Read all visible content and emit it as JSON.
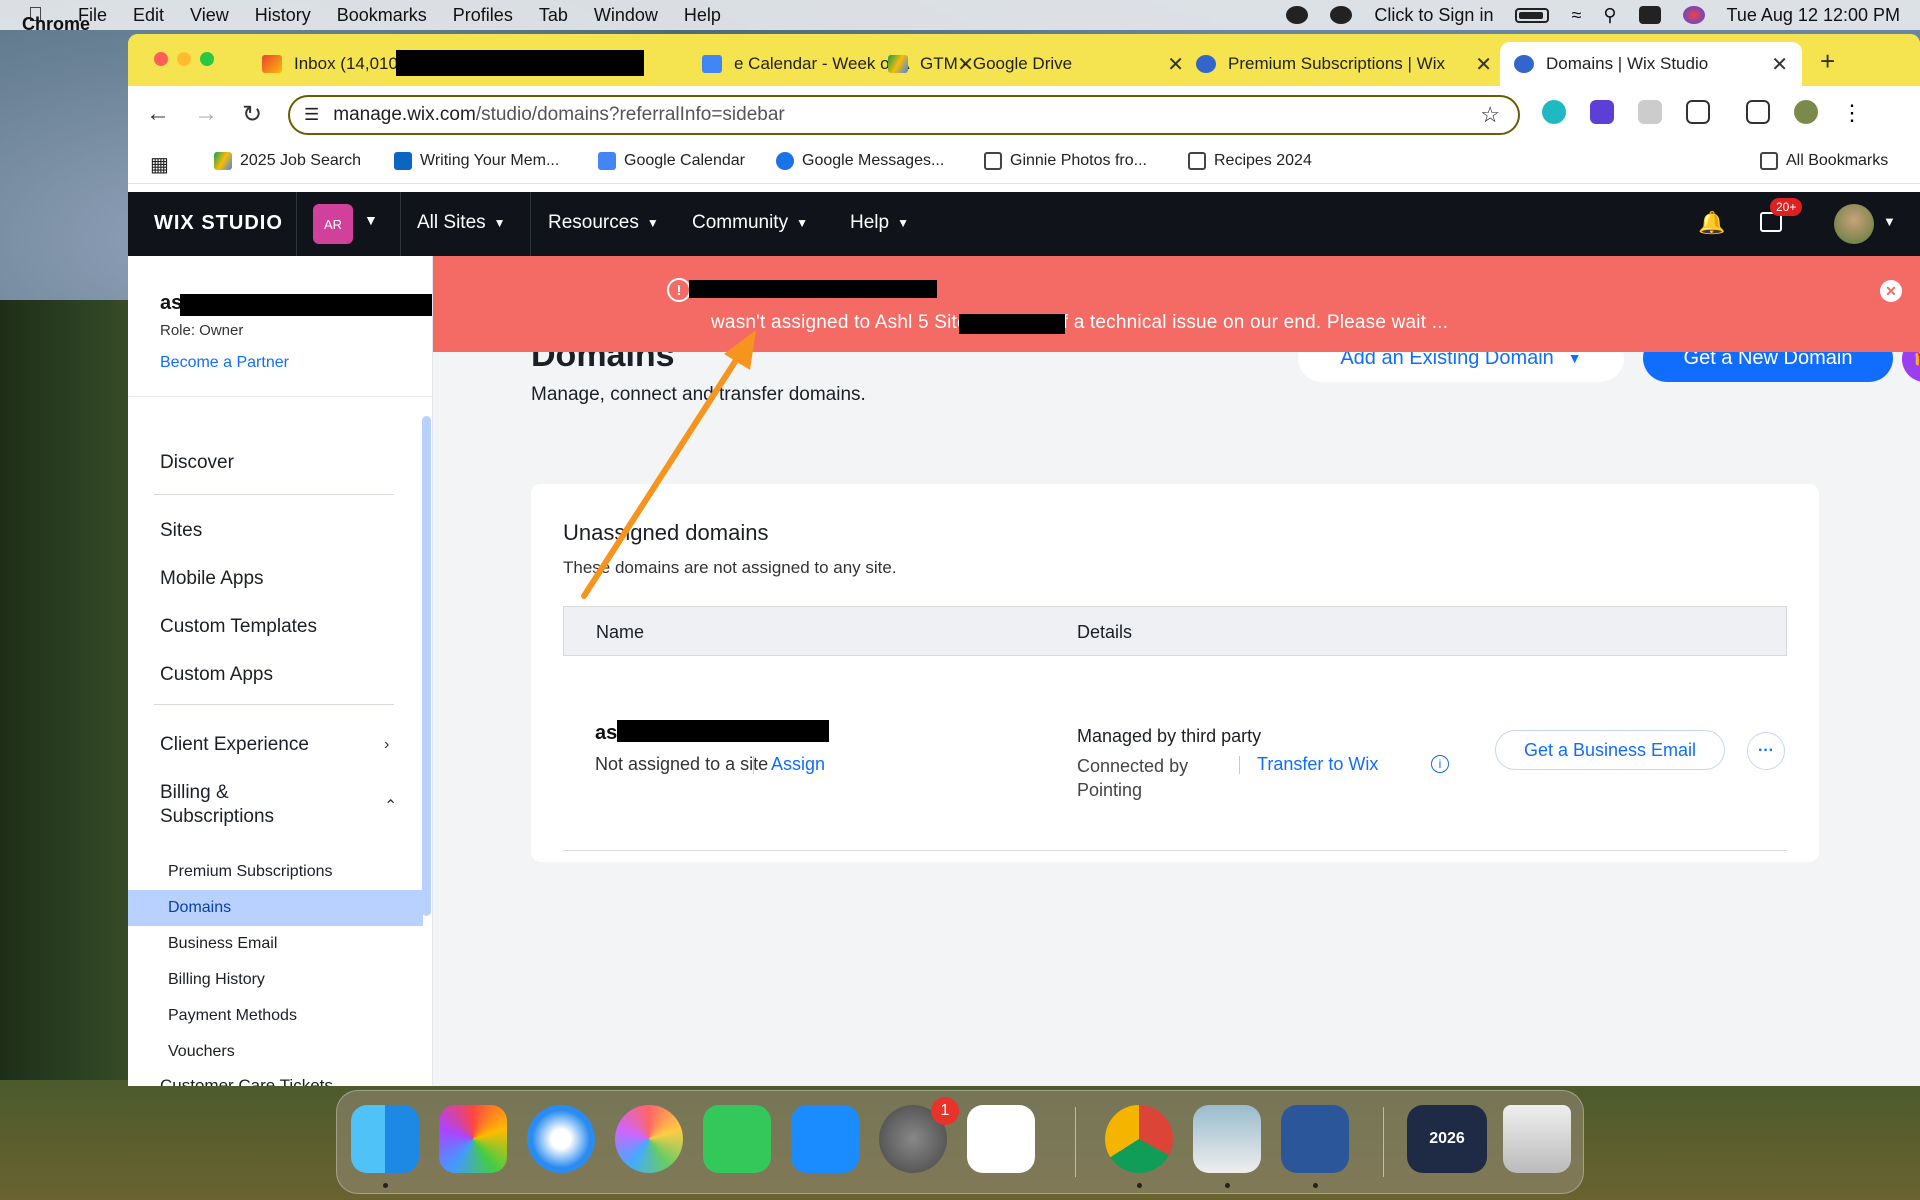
{
  "menubar": {
    "app": "Chrome",
    "items": [
      "File",
      "Edit",
      "View",
      "History",
      "Bookmarks",
      "Profiles",
      "Tab",
      "Window",
      "Help"
    ],
    "sign_in": "Click to Sign in",
    "datetime": "Tue Aug 12  12:00 PM"
  },
  "tabs": [
    {
      "label": "Inbox (14,010)",
      "icon": "gmail-icon"
    },
    {
      "label": "e Calendar - Week of A",
      "icon": "calendar-icon"
    },
    {
      "label": "GTM - Google Drive",
      "icon": "drive-icon"
    },
    {
      "label": "Premium Subscriptions | Wix",
      "icon": "wix-icon"
    },
    {
      "label": "Domains | Wix Studio",
      "icon": "wix-icon",
      "active": true
    }
  ],
  "url": {
    "host": "manage.wix.com",
    "path": "/studio/domains?referralInfo=sidebar"
  },
  "bookmarks": [
    "2025 Job Search",
    "Writing Your Mem...",
    "Google Calendar",
    "Google Messages...",
    "Ginnie Photos fro...",
    "Recipes 2024"
  ],
  "all_bookmarks": "All Bookmarks",
  "wix": {
    "logo": "WIX STUDIO",
    "account_initials": "AR",
    "nav": [
      "All Sites",
      "Resources",
      "Community",
      "Help"
    ],
    "notif_badge": "20+"
  },
  "sidebar": {
    "user": "ash",
    "role": "Role: Owner",
    "partner": "Become a Partner",
    "items": [
      "Discover",
      "Sites",
      "Mobile Apps",
      "Custom Templates",
      "Custom Apps",
      "Client Experience"
    ],
    "billing": "Billing &",
    "billing2": "Subscriptions",
    "billing_sub": [
      "Premium Subscriptions",
      "Domains",
      "Business Email",
      "Billing History",
      "Payment Methods",
      "Vouchers"
    ],
    "cut_item": "Customer Care Tickets"
  },
  "banner": {
    "message": "wasn't assigned to Ashl                5 Site because of a technical issue on our end. Please wait ..."
  },
  "page": {
    "title": "Domains",
    "subtitle": "Manage, connect and transfer domains.",
    "add_existing": "Add an Existing Domain",
    "get_new": "Get a New Domain"
  },
  "card": {
    "title": "Unassigned domains",
    "subtitle": "These domains are not assigned to any site.",
    "col_name": "Name",
    "col_details": "Details",
    "domain": "as",
    "status": "Not assigned to a site",
    "assign": "Assign",
    "managed": "Managed by third party",
    "connected": "Connected by Pointing",
    "transfer": "Transfer to Wix",
    "email_btn": "Get a Business Email",
    "more": "···"
  },
  "dock": {
    "settings_badge": "1",
    "year_label": "2026"
  },
  "colors": {
    "accent": "#116dff",
    "banner": "#f36b64",
    "tabstrip": "#f5e44f"
  }
}
